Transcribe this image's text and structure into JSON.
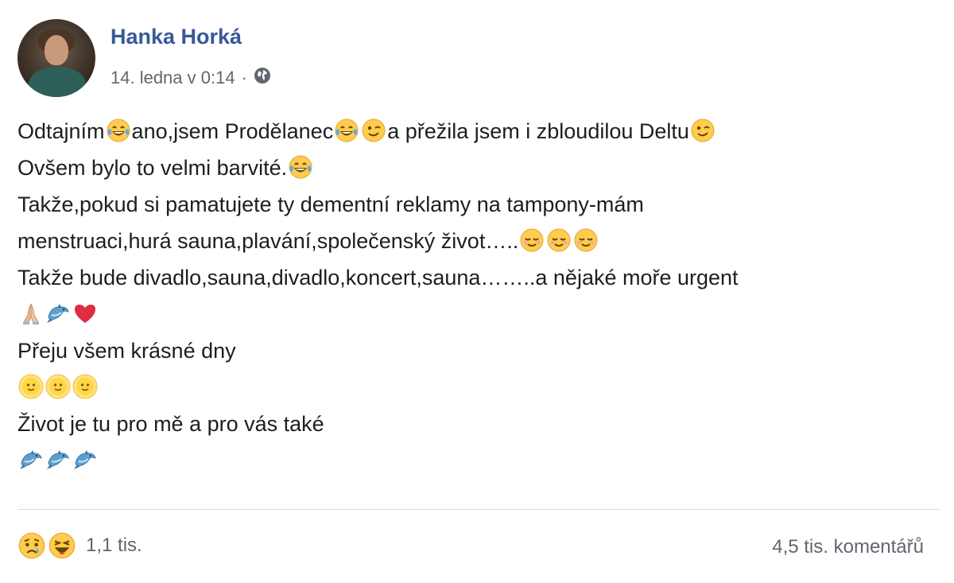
{
  "post": {
    "author": "Hanka Horká",
    "timestamp": "14. ledna v 0:14",
    "separator": "·",
    "privacy_icon": "globe-icon",
    "lines": [
      [
        {
          "t": "Odtajním"
        },
        {
          "e": "tears-of-joy"
        },
        {
          "t": "ano,jsem Prodělanec"
        },
        {
          "e": "tears-of-joy"
        },
        {
          "e": "wink"
        },
        {
          "t": "a přežila jsem i zbloudilou Deltu"
        },
        {
          "e": "wink"
        }
      ],
      [
        {
          "t": "Ovšem bylo to velmi barvité."
        },
        {
          "e": "tears-of-joy"
        }
      ],
      [
        {
          "t": "Takže,pokud si pamatujete ty dementní reklamy na tampony-mám"
        }
      ],
      [
        {
          "t": "menstruaci,hurá sauna,plavání,společenský život….."
        },
        {
          "e": "relieved"
        },
        {
          "e": "relieved"
        },
        {
          "e": "relieved"
        }
      ],
      [
        {
          "t": "Takže bude divadlo,sauna,divadlo,koncert,sauna……..a nějaké moře urgent"
        }
      ],
      [
        {
          "e": "praying-hands"
        },
        {
          "e": "dolphin"
        },
        {
          "e": "red-heart"
        }
      ],
      [
        {
          "t": "Přeju všem krásné dny"
        }
      ],
      [
        {
          "e": "sun-face"
        },
        {
          "e": "sun-face"
        },
        {
          "e": "sun-face"
        }
      ],
      [
        {
          "t": "Život je tu pro mě a pro vás také"
        }
      ],
      [
        {
          "e": "dolphin"
        },
        {
          "e": "dolphin"
        },
        {
          "e": "dolphin"
        }
      ]
    ]
  },
  "footer": {
    "reaction_icons": [
      "sad-reaction",
      "haha-reaction"
    ],
    "reaction_count": "1,1 tis.",
    "comment_count": "4,5 tis. komentářů"
  },
  "colors": {
    "author_link": "#385898",
    "meta_text": "#606770",
    "body_text": "#1c1e21",
    "divider": "#dadde1"
  }
}
